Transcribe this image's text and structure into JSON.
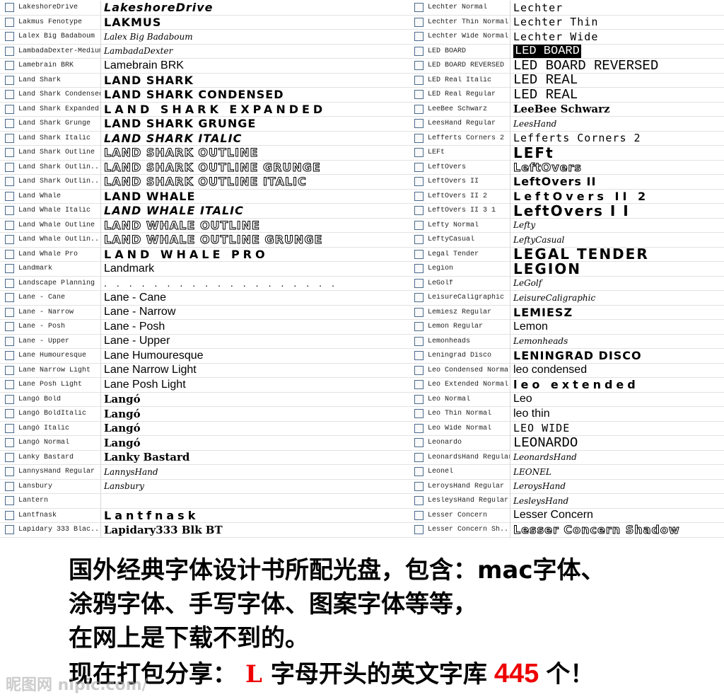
{
  "left_fonts": [
    {
      "name": "LakeshoreDrive",
      "sample": "LakeshoreDrive",
      "style": "italic"
    },
    {
      "name": "Lakmus Fenotype",
      "sample": "LAKMUS",
      "style": "bold"
    },
    {
      "name": "Lalex Big Badaboum",
      "sample": "Lalex Big Badaboum",
      "style": "script"
    },
    {
      "name": "LambadaDexter-Medium",
      "sample": "LambadaDexter",
      "style": "script"
    },
    {
      "name": "Lamebrain BRK",
      "sample": "Lamebrain BRK",
      "style": "plain"
    },
    {
      "name": "Land Shark",
      "sample": "LAND SHARK",
      "style": "bold"
    },
    {
      "name": "Land Shark Condensed",
      "sample": "LAND SHARK CONDENSED",
      "style": "bold"
    },
    {
      "name": "Land Shark Expanded",
      "sample": "LAND SHARK EXPANDED",
      "style": "wide"
    },
    {
      "name": "Land Shark Grunge",
      "sample": "LAND SHARK GRUNGE",
      "style": "bold"
    },
    {
      "name": "Land Shark Italic",
      "sample": "LAND SHARK ITALIC",
      "style": "italic"
    },
    {
      "name": "Land Shark Outline",
      "sample": "LAND SHARK OUTLINE",
      "style": "outline"
    },
    {
      "name": "Land Shark Outlin...",
      "sample": "LAND SHARK OUTLINE GRUNGE",
      "style": "outline"
    },
    {
      "name": "Land Shark Outlin...",
      "sample": "LAND SHARK OUTLINE ITALIC",
      "style": "outline"
    },
    {
      "name": "Land Whale",
      "sample": "LAND WHALE",
      "style": "bold"
    },
    {
      "name": "Land Whale Italic",
      "sample": "LAND WHALE ITALIC",
      "style": "italic"
    },
    {
      "name": "Land Whale Outline",
      "sample": "LAND WHALE OUTLINE",
      "style": "outline"
    },
    {
      "name": "Land Whale Outlin...",
      "sample": "LAND WHALE OUTLINE GRUNGE",
      "style": "outline"
    },
    {
      "name": "Land Whale Pro",
      "sample": "LAND WHALE PRO",
      "style": "wide"
    },
    {
      "name": "Landmark",
      "sample": "Landmark",
      "style": "plain"
    },
    {
      "name": "Landscape Planning",
      "sample": "...................",
      "style": "dots"
    },
    {
      "name": "Lane - Cane",
      "sample": "Lane - Cane",
      "style": "plain"
    },
    {
      "name": "Lane - Narrow",
      "sample": "Lane - Narrow",
      "style": "plain"
    },
    {
      "name": "Lane - Posh",
      "sample": "Lane - Posh",
      "style": "plain"
    },
    {
      "name": "Lane - Upper",
      "sample": "Lane - Upper",
      "style": "plain"
    },
    {
      "name": "Lane Humouresque",
      "sample": "Lane Humouresque",
      "style": "plain"
    },
    {
      "name": "Lane Narrow Light",
      "sample": "Lane Narrow Light",
      "style": "plain"
    },
    {
      "name": "Lane Posh Light",
      "sample": "Lane Posh Light",
      "style": "plain"
    },
    {
      "name": "Langó Bold",
      "sample": "Langó",
      "style": "serif"
    },
    {
      "name": "Langó BoldItalic",
      "sample": "Langó",
      "style": "serif"
    },
    {
      "name": "Langó Italic",
      "sample": "Langó",
      "style": "serif"
    },
    {
      "name": "Langó Normal",
      "sample": "Langó",
      "style": "serif"
    },
    {
      "name": "Lanky Bastard",
      "sample": "Lanky Bastard",
      "style": "serif"
    },
    {
      "name": "LannysHand Regular",
      "sample": "LannysHand",
      "style": "script"
    },
    {
      "name": "Lansbury",
      "sample": "Lansbury",
      "style": "script"
    },
    {
      "name": "Lantern",
      "sample": "",
      "style": "bold"
    },
    {
      "name": "Lantfnask",
      "sample": "Lantfnask",
      "style": "wide"
    },
    {
      "name": "Lapidary 333 Blac...",
      "sample": "Lapidary333 Blk BT",
      "style": "serif"
    }
  ],
  "right_fonts": [
    {
      "name": "Lechter Normal",
      "sample": "Lechter",
      "style": "thin"
    },
    {
      "name": "Lechter Thin Normal",
      "sample": "Lechter Thin",
      "style": "thin"
    },
    {
      "name": "Lechter Wide Normal",
      "sample": "Lechter Wide",
      "style": "thin"
    },
    {
      "name": "LED BOARD",
      "sample": "LED BOARD",
      "style": "reverse"
    },
    {
      "name": "LED BOARD REVERSED",
      "sample": "LED BOARD REVERSED",
      "style": "mono"
    },
    {
      "name": "LED Real Italic",
      "sample": "LED REAL",
      "style": "mono"
    },
    {
      "name": "LED Real Regular",
      "sample": "LED REAL",
      "style": "mono"
    },
    {
      "name": "LeeBee Schwarz",
      "sample": "LeeBee Schwarz",
      "style": "serif"
    },
    {
      "name": "LeesHand Regular",
      "sample": "LeesHand",
      "style": "script"
    },
    {
      "name": "Lefferts Corners  2",
      "sample": "Lefferts Corners 2",
      "style": "thin"
    },
    {
      "name": "LEFt",
      "sample": "LEFt",
      "style": "big"
    },
    {
      "name": "LeftOvers",
      "sample": "LeftOvers",
      "style": "outline"
    },
    {
      "name": "LeftOvers II",
      "sample": "LeftOvers II",
      "style": "bold"
    },
    {
      "name": "LeftOvers II 2",
      "sample": "LeftOvers II 2",
      "style": "wide"
    },
    {
      "name": "LeftOvers II 3 1",
      "sample": "LeftOvers I I",
      "style": "big"
    },
    {
      "name": "Lefty Normal",
      "sample": "Lefty",
      "style": "script"
    },
    {
      "name": "LeftyCasual",
      "sample": "LeftyCasual",
      "style": "script"
    },
    {
      "name": "Legal Tender",
      "sample": "LEGAL TENDER",
      "style": "big"
    },
    {
      "name": "Legion",
      "sample": "LEGION",
      "style": "big"
    },
    {
      "name": "LeGolf",
      "sample": "LeGolf",
      "style": "script"
    },
    {
      "name": "LeisureCaligraphic",
      "sample": "LeisureCaligraphic",
      "style": "script"
    },
    {
      "name": "Lemiesz Regular",
      "sample": "LEMIESZ",
      "style": "bold"
    },
    {
      "name": "Lemon Regular",
      "sample": "Lemon",
      "style": "plain"
    },
    {
      "name": "Lemonheads",
      "sample": "Lemonheads",
      "style": "script"
    },
    {
      "name": "Leningrad Disco",
      "sample": "LENINGRAD DISCO",
      "style": "bold"
    },
    {
      "name": "Leo Condensed Normal",
      "sample": "leo condensed",
      "style": "plain"
    },
    {
      "name": "Leo Extended Normal",
      "sample": "leo extended",
      "style": "wide"
    },
    {
      "name": "Leo Normal",
      "sample": "Leo",
      "style": "plain"
    },
    {
      "name": "Leo Thin Normal",
      "sample": "leo thin",
      "style": "plain"
    },
    {
      "name": "Leo Wide Normal",
      "sample": "LEO WIDE",
      "style": "thin"
    },
    {
      "name": "Leonardo",
      "sample": "LEONARDO",
      "style": "mono"
    },
    {
      "name": "LeonardsHand Regular",
      "sample": "LeonardsHand",
      "style": "script"
    },
    {
      "name": "Leonel",
      "sample": "LEONEL",
      "style": "script"
    },
    {
      "name": "LeroysHand Regular",
      "sample": "LeroysHand",
      "style": "script"
    },
    {
      "name": "LesleysHand Regular",
      "sample": "LesleysHand",
      "style": "script"
    },
    {
      "name": "Lesser Concern",
      "sample": "Lesser Concern",
      "style": "plain"
    },
    {
      "name": "Lesser Concern Sh...",
      "sample": "Lesser Concern Shadow",
      "style": "outline"
    }
  ],
  "caption": {
    "line1": "国外经典字体设计书所配光盘，包含：mac字体、",
    "line2": "涂鸦字体、手写字体、图案字体等等，",
    "line3": "在网上是下载不到的。",
    "line4_a": "现在打包分享：",
    "letter": "L",
    "line4_b": "字母开头的英文字库",
    "count": "445",
    "line4_c": "个！"
  },
  "watermark": "昵图网 nipic.com/",
  "colors": {
    "accent": "#ee0000"
  }
}
